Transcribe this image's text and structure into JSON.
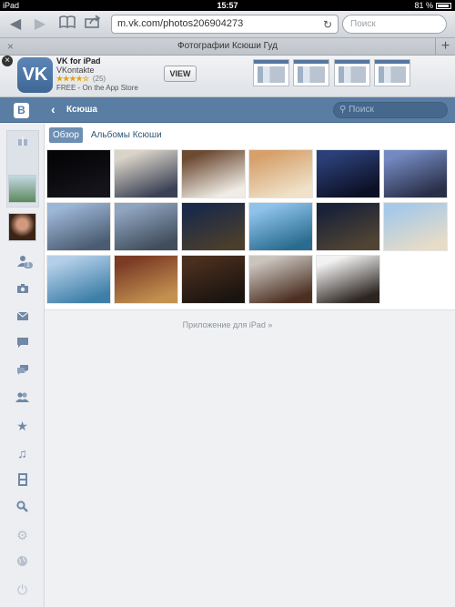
{
  "status": {
    "device": "iPad",
    "time": "15:57",
    "battery": "81 %"
  },
  "browser": {
    "url": "m.vk.com/photos206904273",
    "search_placeholder": "Поиск",
    "tab_title": "Фотографии Ксюши Гуд"
  },
  "banner": {
    "app_name": "VK for iPad",
    "developer": "VKontakte",
    "stars": "★★★★☆",
    "rating_count": "(25)",
    "price": "FREE - On the App Store",
    "view_label": "VIEW",
    "logo_text": "VK"
  },
  "vk": {
    "logo": "B",
    "title": "Ксюша",
    "search_placeholder": "Поиск"
  },
  "tabs": [
    "Обзор",
    "Альбомы Ксюши"
  ],
  "sidebar": {
    "friends_badge": "1"
  },
  "photos": [
    {
      "row": 0,
      "col": 0,
      "c1": "#050507",
      "c2": "#14141a"
    },
    {
      "row": 0,
      "col": 1,
      "c1": "#d9d3c8",
      "c2": "#3b4155"
    },
    {
      "row": 0,
      "col": 2,
      "c1": "#6d4b33",
      "c2": "#f0ede6"
    },
    {
      "row": 0,
      "col": 3,
      "c1": "#d6a06b",
      "c2": "#efe2c9"
    },
    {
      "row": 0,
      "col": 4,
      "c1": "#2b3f78",
      "c2": "#0c1024"
    },
    {
      "row": 0,
      "col": 5,
      "c1": "#7389c0",
      "c2": "#2a2f48"
    },
    {
      "row": 1,
      "col": 0,
      "c1": "#9cb6d6",
      "c2": "#4b5c72"
    },
    {
      "row": 1,
      "col": 1,
      "c1": "#8fa4bf",
      "c2": "#404d5c"
    },
    {
      "row": 1,
      "col": 2,
      "c1": "#1b2a48",
      "c2": "#4a3e2c"
    },
    {
      "row": 1,
      "col": 3,
      "c1": "#8ec3ec",
      "c2": "#2a6c8f"
    },
    {
      "row": 1,
      "col": 4,
      "c1": "#1a2238",
      "c2": "#514433"
    },
    {
      "row": 1,
      "col": 5,
      "c1": "#a7c9e8",
      "c2": "#e6dcc7"
    },
    {
      "row": 2,
      "col": 0,
      "c1": "#b4cfe9",
      "c2": "#3e7fa8"
    },
    {
      "row": 2,
      "col": 1,
      "c1": "#7b3b25",
      "c2": "#c29150"
    },
    {
      "row": 2,
      "col": 2,
      "c1": "#4a2e1e",
      "c2": "#1a1410"
    },
    {
      "row": 2,
      "col": 3,
      "c1": "#c9c4bd",
      "c2": "#4c2f22"
    },
    {
      "row": 2,
      "col": 4,
      "c1": "#f2f2f2",
      "c2": "#2b2420"
    }
  ],
  "footer": "Приложение для iPad »"
}
